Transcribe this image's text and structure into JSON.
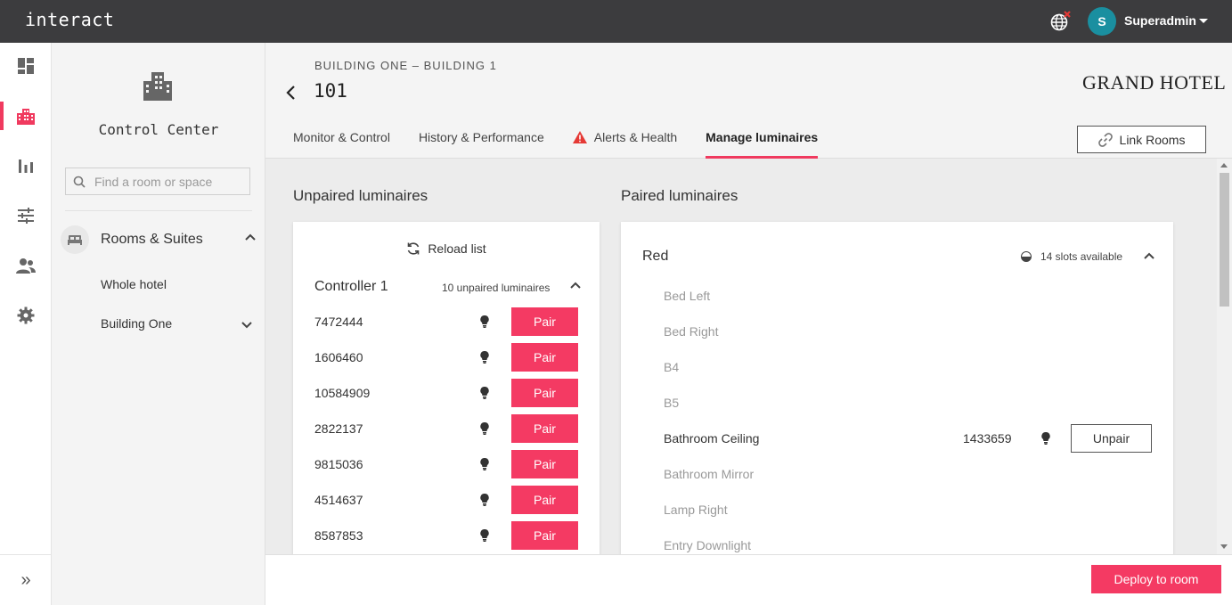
{
  "app": {
    "brand": "interact"
  },
  "user": {
    "initial": "S",
    "name": "Superadmin"
  },
  "colors": {
    "accent": "#f43a63",
    "topbar": "#3c3c3e",
    "avatar": "#1a8fa0",
    "alert": "#e53935"
  },
  "rail": {
    "items": [
      {
        "icon": "dashboard-icon"
      },
      {
        "icon": "building-icon",
        "active": true
      },
      {
        "icon": "bar-chart-icon"
      },
      {
        "icon": "sliders-icon"
      },
      {
        "icon": "users-icon"
      },
      {
        "icon": "gear-icon"
      }
    ],
    "expand_icon": "»"
  },
  "sidebar": {
    "title": "Control Center",
    "search_placeholder": "Find a room or space",
    "section_label": "Rooms & Suites",
    "links": [
      "Whole hotel",
      "Building One"
    ]
  },
  "header": {
    "breadcrumb": "BUILDING ONE – BUILDING 1",
    "room": "101",
    "logo": "GRAND HOTEL",
    "tabs": [
      {
        "label": "Monitor & Control"
      },
      {
        "label": "History & Performance"
      },
      {
        "label": "Alerts & Health",
        "warning": true
      },
      {
        "label": "Manage luminaires",
        "active": true
      }
    ],
    "link_rooms_label": "Link Rooms"
  },
  "unpaired": {
    "title": "Unpaired luminaires",
    "reload_label": "Reload list",
    "controller_name": "Controller 1",
    "controller_count": "10 unpaired luminaires",
    "pair_label": "Pair",
    "luminaires": [
      "7472444",
      "1606460",
      "10584909",
      "2822137",
      "9815036",
      "4514637",
      "8587853"
    ]
  },
  "paired": {
    "title": "Paired luminaires",
    "group_name": "Red",
    "slots_text": "14 slots available",
    "unpair_label": "Unpair",
    "slots": [
      {
        "name": "Bed Left"
      },
      {
        "name": "Bed Right"
      },
      {
        "name": "B4"
      },
      {
        "name": "B5"
      },
      {
        "name": "Bathroom Ceiling",
        "luminaire": "1433659"
      },
      {
        "name": "Bathroom Mirror"
      },
      {
        "name": "Lamp Right"
      },
      {
        "name": "Entry Downlight"
      }
    ]
  },
  "footer": {
    "deploy_label": "Deploy to room"
  }
}
